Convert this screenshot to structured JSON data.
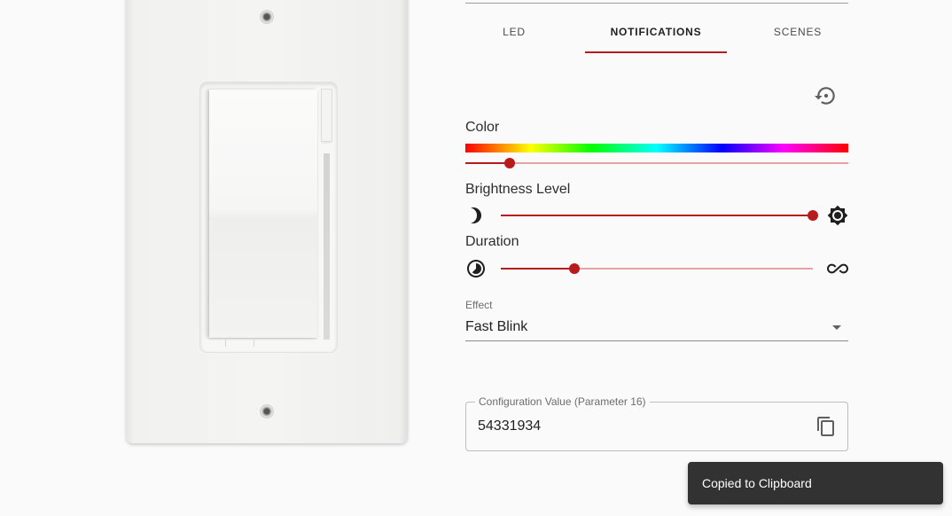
{
  "tabs": [
    {
      "label": "LED",
      "active": false
    },
    {
      "label": "NOTIFICATIONS",
      "active": true
    },
    {
      "label": "SCENES",
      "active": false
    }
  ],
  "notifications": {
    "reset_icon": "settings-backup-restore-icon",
    "color": {
      "label": "Color",
      "value_fraction": 0.115
    },
    "brightness": {
      "label": "Brightness Level",
      "value_fraction": 1.0,
      "min_icon": "moon-icon",
      "max_icon": "brightness-high-icon"
    },
    "duration": {
      "label": "Duration",
      "value_fraction": 0.235,
      "min_icon": "timelapse-icon",
      "max_icon": "infinity-icon"
    },
    "effect": {
      "label": "Effect",
      "value": "Fast Blink"
    },
    "config": {
      "label": "Configuration Value (Parameter 16)",
      "value": "54331934",
      "copy_icon": "content-copy-icon"
    }
  },
  "snackbar": {
    "message": "Copied to Clipboard"
  },
  "colors": {
    "accent": "#b71c1c",
    "track_inactive": "#e6a2a2",
    "snackbar_bg": "#323232",
    "page_bg": "#fafafa"
  }
}
